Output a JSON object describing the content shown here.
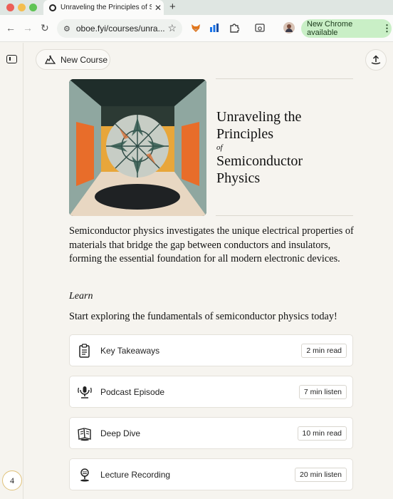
{
  "browser": {
    "tab_title": "Unraveling the Principles of S",
    "url": "oboe.fyi/courses/unra...",
    "new_chrome_label": "New Chrome available"
  },
  "app": {
    "new_course_label": "New Course",
    "step_number": "4"
  },
  "course": {
    "title_line1": "Unraveling the",
    "title_line2": "Principles",
    "title_of": "of",
    "title_line3": "Semiconductor",
    "title_line4": "Physics",
    "description": "Semiconductor physics investigates the unique electrical properties of materials that bridge the gap between conductors and insulators, forming the essential foundation for all modern electronic devices.",
    "learn_heading": "Learn",
    "learn_subtitle": "Start exploring the fundamentals of semiconductor physics today!"
  },
  "items": [
    {
      "label": "Key Takeaways",
      "duration": "2 min read",
      "icon": "clipboard-list-icon"
    },
    {
      "label": "Podcast Episode",
      "duration": "7 min listen",
      "icon": "podcast-mic-icon"
    },
    {
      "label": "Deep Dive",
      "duration": "10 min read",
      "icon": "open-book-icon"
    },
    {
      "label": "Lecture Recording",
      "duration": "20 min listen",
      "icon": "lecture-mic-icon"
    }
  ],
  "colors": {
    "page_bg": "#f6f4ef",
    "new_chrome_bg": "#c9efc6",
    "step_ring": "#e0c27a"
  }
}
